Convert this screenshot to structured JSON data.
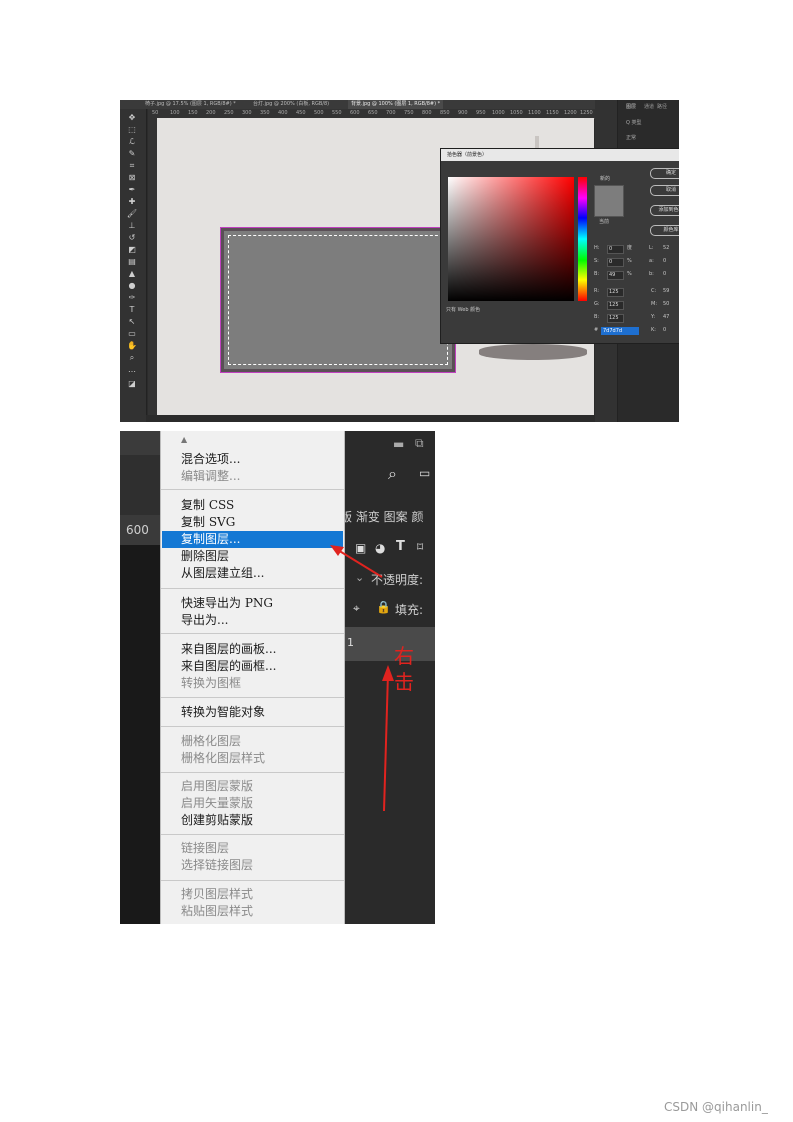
{
  "photoshop": {
    "tabs": [
      "椅子.jpg @ 17.5% (图层 1, RGB/8#) *",
      "台灯.jpg @ 200% (白板, RGB/8)",
      "背景.jpg @ 100% (图层 1, RGB/8#) *"
    ],
    "ruler_numbers": [
      "50",
      "100",
      "150",
      "200",
      "250",
      "300",
      "350",
      "400",
      "450",
      "500",
      "550",
      "600",
      "650",
      "700",
      "750",
      "800",
      "850",
      "900",
      "950",
      "1000",
      "1050",
      "1100",
      "1150",
      "1200",
      "1250"
    ],
    "right_panel_tabs": [
      "图层",
      "通道",
      "路径"
    ],
    "right_panel_search": "Q 类型",
    "right_panel_mode": "正常"
  },
  "color_picker": {
    "title": "拾色器（前景色）",
    "new_label": "新的",
    "current_label": "当前",
    "buttons": [
      "确定",
      "取消",
      "添加到色板",
      "颜色库"
    ],
    "web_only_label": "只有 Web 颜色",
    "fields": {
      "H": {
        "label": "H:",
        "value": "0",
        "unit": "度"
      },
      "S": {
        "label": "S:",
        "value": "0",
        "unit": "%"
      },
      "Bv": {
        "label": "B:",
        "value": "49",
        "unit": "%"
      },
      "R": {
        "label": "R:",
        "value": "125"
      },
      "G": {
        "label": "G:",
        "value": "125"
      },
      "Bc": {
        "label": "B:",
        "value": "125"
      },
      "L": {
        "label": "L:",
        "value": "52"
      },
      "a": {
        "label": "a:",
        "value": "0"
      },
      "b": {
        "label": "b:",
        "value": "0"
      },
      "C": {
        "label": "C:",
        "value": "59"
      },
      "M": {
        "label": "M:",
        "value": "50"
      },
      "Y": {
        "label": "Y:",
        "value": "47"
      },
      "K": {
        "label": "K:",
        "value": "0"
      }
    },
    "hex_label": "#",
    "hex_value": "7d7d7d",
    "color": "#7d7d7d"
  },
  "context_menu": {
    "ruler_text": "600",
    "right_panel": {
      "tabs": "版 渐变 图案 颜",
      "opacity_label": "不透明度:",
      "fill_label": "填充:",
      "layer_name": "1"
    },
    "groups": [
      [
        "混合选项...",
        "编辑调整..."
      ],
      [
        "复制 CSS",
        "复制 SVG",
        "复制图层...",
        "删除图层",
        "从图层建立组..."
      ],
      [
        "快速导出为 PNG",
        "导出为..."
      ],
      [
        "来自图层的画板...",
        "来自图层的画框...",
        "转换为图框"
      ],
      [
        "转换为智能对象"
      ],
      [
        "栅格化图层",
        "栅格化图层样式"
      ],
      [
        "启用图层蒙版",
        "启用矢量蒙版",
        "创建剪贴蒙版"
      ],
      [
        "链接图层",
        "选择链接图层"
      ],
      [
        "拷贝图层样式",
        "粘贴图层样式"
      ]
    ],
    "highlighted": "复制图层...",
    "annotation": [
      "右",
      "击"
    ],
    "colors": {
      "highlight": "#1478d4",
      "annotation": "#e0231f"
    }
  },
  "watermark": "CSDN @qihanlin_"
}
